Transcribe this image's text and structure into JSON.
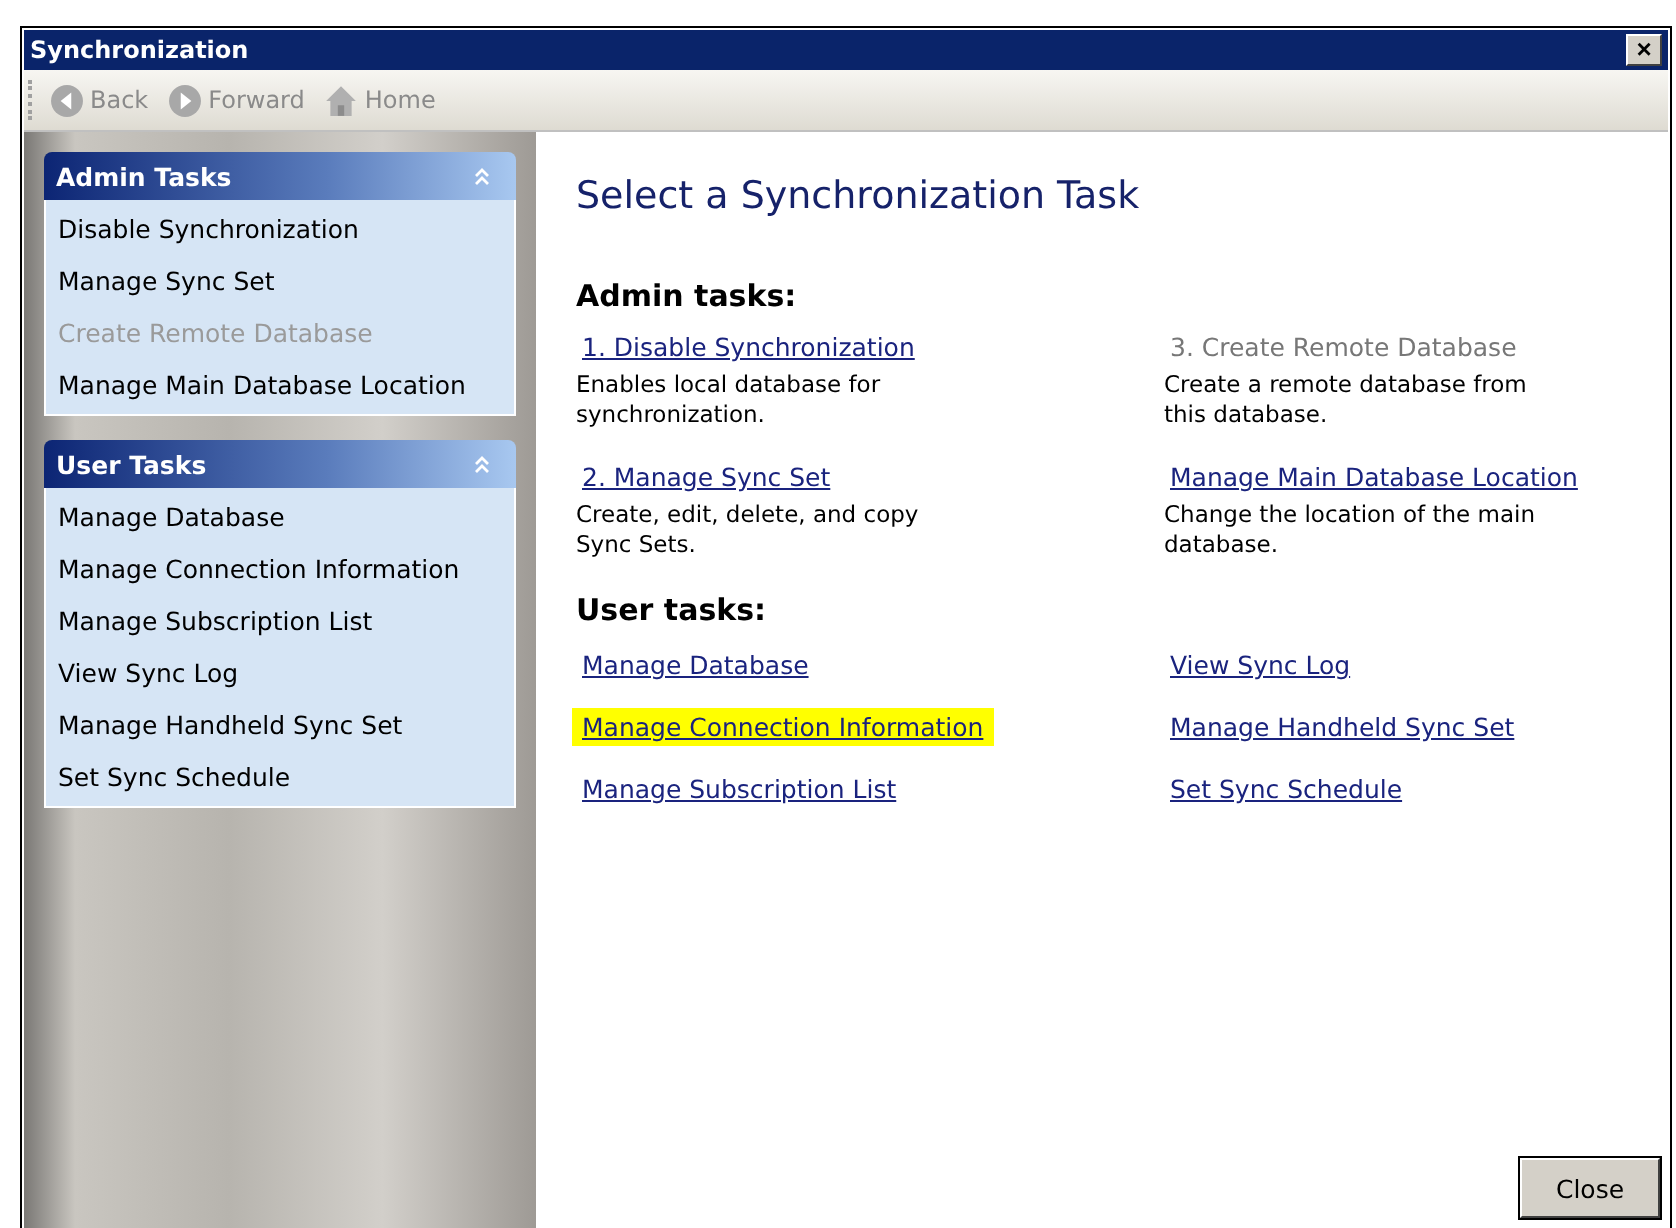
{
  "window": {
    "title": "Synchronization",
    "close": "×"
  },
  "toolbar": [
    {
      "kind": "back",
      "label": "Back",
      "disabled": true
    },
    {
      "kind": "forward",
      "label": "Forward",
      "disabled": true
    },
    {
      "kind": "home",
      "label": "Home",
      "disabled": true
    }
  ],
  "sidebar": {
    "groups": [
      {
        "title": "Admin Tasks",
        "expanded": true,
        "items": [
          {
            "label": "Disable Synchronization",
            "disabled": false
          },
          {
            "label": "Manage Sync Set",
            "disabled": false
          },
          {
            "label": "Create Remote Database",
            "disabled": true
          },
          {
            "label": "Manage Main Database Location",
            "disabled": false
          }
        ]
      },
      {
        "title": "User Tasks",
        "expanded": true,
        "items": [
          {
            "label": "Manage Database",
            "disabled": false
          },
          {
            "label": "Manage Connection Information",
            "disabled": false
          },
          {
            "label": "Manage Subscription List",
            "disabled": false
          },
          {
            "label": "View Sync Log",
            "disabled": false
          },
          {
            "label": "Manage Handheld Sync Set",
            "disabled": false
          },
          {
            "label": "Set Sync Schedule",
            "disabled": false
          }
        ]
      }
    ]
  },
  "main": {
    "title": "Select a Synchronization Task",
    "admin": {
      "heading": "Admin tasks:",
      "tasks": [
        {
          "label": "1. Disable Synchronization",
          "description": "Enables local database for synchronization.",
          "disabled": false
        },
        {
          "label": "3. Create Remote Database",
          "description": "Create a remote database from this database.",
          "disabled": true
        },
        {
          "label": "2. Manage Sync Set",
          "description": "Create, edit, delete, and copy Sync Sets.",
          "disabled": false
        },
        {
          "label": "Manage Main Database Location",
          "description": "Change the location of the main database.",
          "disabled": false
        }
      ]
    },
    "user": {
      "heading": "User tasks:",
      "links": [
        {
          "label": "Manage Database",
          "highlighted": false
        },
        {
          "label": "View Sync Log",
          "highlighted": false
        },
        {
          "label": "Manage Connection Information",
          "highlighted": true
        },
        {
          "label": "Manage Handheld Sync Set",
          "highlighted": false
        },
        {
          "label": "Manage Subscription List",
          "highlighted": false
        },
        {
          "label": "Set Sync Schedule",
          "highlighted": false
        }
      ]
    }
  },
  "buttons": [
    "Close"
  ]
}
